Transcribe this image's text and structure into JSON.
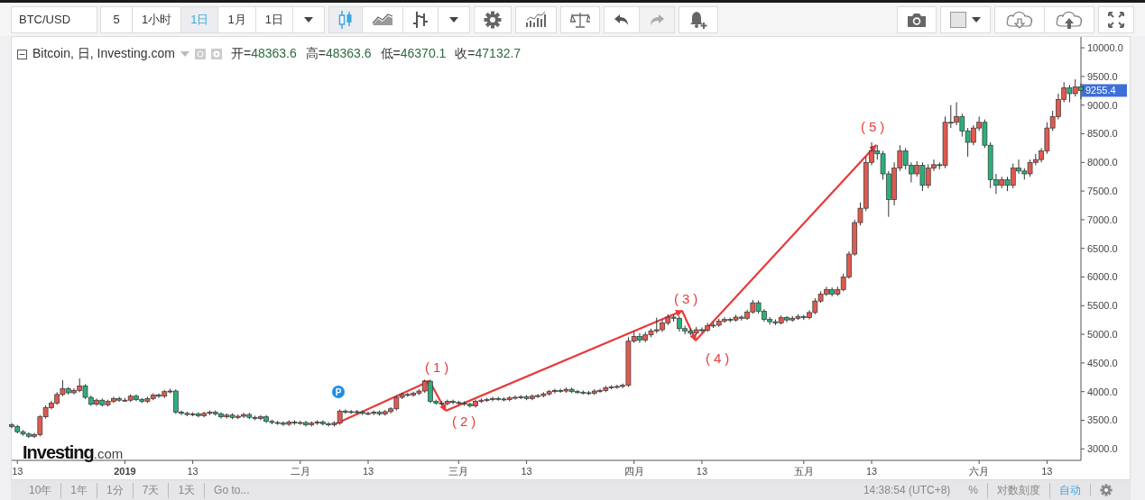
{
  "toolbar": {
    "symbol": "BTC/USD",
    "intervals": [
      {
        "label": "5",
        "selected": false
      },
      {
        "label": "1小时",
        "selected": false
      },
      {
        "label": "1日",
        "selected": true
      },
      {
        "label": "1月",
        "selected": false
      },
      {
        "label": "1日",
        "selected": false
      }
    ],
    "chart_types": [
      {
        "kind": "candles",
        "selected": true
      },
      {
        "kind": "area",
        "selected": false
      },
      {
        "kind": "bars",
        "selected": false
      }
    ],
    "history": [
      {
        "kind": "undo",
        "disabled": false
      },
      {
        "kind": "redo",
        "disabled": true
      }
    ]
  },
  "legend": {
    "title": "Bitcoin, 日, Investing.com",
    "values": [
      {
        "label": "开=",
        "value": "48363.6"
      },
      {
        "label": "高=",
        "value": "48363.6"
      },
      {
        "label": "低=",
        "value": "46370.1"
      },
      {
        "label": "收=",
        "value": "47132.7"
      }
    ]
  },
  "chart": {
    "price_tag": "9255.4",
    "event_marker": "P",
    "annotations": [
      "(1)",
      "(2)",
      "(3)",
      "(4)",
      "(5)"
    ],
    "logo": {
      "name": "Investing",
      "suffix": ".com"
    },
    "chart_data": {
      "type": "candlestick",
      "xlim": [
        "2018-12-12",
        "2019-06-19"
      ],
      "ylim": [
        2800,
        10190
      ],
      "yticks": [
        {
          "value": 10000,
          "label": "10000.0"
        },
        {
          "value": 9500,
          "label": "9500.0"
        },
        {
          "value": 9000,
          "label": "9000.0"
        },
        {
          "value": 8500,
          "label": "8500.0"
        },
        {
          "value": 8000,
          "label": "8000.0"
        },
        {
          "value": 7500,
          "label": "7500.0"
        },
        {
          "value": 7000,
          "label": "7000.0"
        },
        {
          "value": 6500,
          "label": "6500.0"
        },
        {
          "value": 6000,
          "label": "6000.0"
        },
        {
          "value": 5500,
          "label": "5500.0"
        },
        {
          "value": 5000,
          "label": "5000.0"
        },
        {
          "value": 4500,
          "label": "4500.0"
        },
        {
          "value": 4000,
          "label": "4000.0"
        },
        {
          "value": 3500,
          "label": "3500.0"
        },
        {
          "value": 3000,
          "label": "3000.0"
        }
      ],
      "xticks": [
        {
          "value": "2018-12-13",
          "label": "13"
        },
        {
          "value": "2019-01-01",
          "label": "2019"
        },
        {
          "value": "2019-01-13",
          "label": "13"
        },
        {
          "value": "2019-02-01",
          "label": "二月"
        },
        {
          "value": "2019-02-13",
          "label": "13"
        },
        {
          "value": "2019-03-01",
          "label": "三月"
        },
        {
          "value": "2019-03-13",
          "label": "13"
        },
        {
          "value": "2019-04-01",
          "label": "四月"
        },
        {
          "value": "2019-04-13",
          "label": "13"
        },
        {
          "value": "2019-05-01",
          "label": "五月"
        },
        {
          "value": "2019-05-13",
          "label": "13"
        },
        {
          "value": "2019-06-01",
          "label": "六月"
        },
        {
          "value": "2019-06-13",
          "label": "13"
        }
      ],
      "x": [
        "2018-12-12",
        "2018-12-13",
        "2018-12-14",
        "2018-12-15",
        "2018-12-16",
        "2018-12-17",
        "2018-12-18",
        "2018-12-19",
        "2018-12-20",
        "2018-12-21",
        "2018-12-22",
        "2018-12-23",
        "2018-12-24",
        "2018-12-25",
        "2018-12-26",
        "2018-12-27",
        "2018-12-28",
        "2018-12-29",
        "2018-12-30",
        "2018-12-31",
        "2019-01-01",
        "2019-01-02",
        "2019-01-03",
        "2019-01-04",
        "2019-01-05",
        "2019-01-06",
        "2019-01-07",
        "2019-01-08",
        "2019-01-09",
        "2019-01-10",
        "2019-01-11",
        "2019-01-12",
        "2019-01-13",
        "2019-01-14",
        "2019-01-15",
        "2019-01-16",
        "2019-01-17",
        "2019-01-18",
        "2019-01-19",
        "2019-01-20",
        "2019-01-21",
        "2019-01-22",
        "2019-01-23",
        "2019-01-24",
        "2019-01-25",
        "2019-01-26",
        "2019-01-27",
        "2019-01-28",
        "2019-01-29",
        "2019-01-30",
        "2019-01-31",
        "2019-02-01",
        "2019-02-02",
        "2019-02-03",
        "2019-02-04",
        "2019-02-05",
        "2019-02-06",
        "2019-02-07",
        "2019-02-08",
        "2019-02-09",
        "2019-02-10",
        "2019-02-11",
        "2019-02-12",
        "2019-02-13",
        "2019-02-14",
        "2019-02-15",
        "2019-02-16",
        "2019-02-17",
        "2019-02-18",
        "2019-02-19",
        "2019-02-20",
        "2019-02-21",
        "2019-02-22",
        "2019-02-23",
        "2019-02-24",
        "2019-02-25",
        "2019-02-26",
        "2019-02-27",
        "2019-02-28",
        "2019-03-01",
        "2019-03-02",
        "2019-03-03",
        "2019-03-04",
        "2019-03-05",
        "2019-03-06",
        "2019-03-07",
        "2019-03-08",
        "2019-03-09",
        "2019-03-10",
        "2019-03-11",
        "2019-03-12",
        "2019-03-13",
        "2019-03-14",
        "2019-03-15",
        "2019-03-16",
        "2019-03-17",
        "2019-03-18",
        "2019-03-19",
        "2019-03-20",
        "2019-03-21",
        "2019-03-22",
        "2019-03-23",
        "2019-03-24",
        "2019-03-25",
        "2019-03-26",
        "2019-03-27",
        "2019-03-28",
        "2019-03-29",
        "2019-03-30",
        "2019-03-31",
        "2019-04-01",
        "2019-04-02",
        "2019-04-03",
        "2019-04-04",
        "2019-04-05",
        "2019-04-06",
        "2019-04-07",
        "2019-04-08",
        "2019-04-09",
        "2019-04-10",
        "2019-04-11",
        "2019-04-12",
        "2019-04-13",
        "2019-04-14",
        "2019-04-15",
        "2019-04-16",
        "2019-04-17",
        "2019-04-18",
        "2019-04-19",
        "2019-04-20",
        "2019-04-21",
        "2019-04-22",
        "2019-04-23",
        "2019-04-24",
        "2019-04-25",
        "2019-04-26",
        "2019-04-27",
        "2019-04-28",
        "2019-04-29",
        "2019-04-30",
        "2019-05-01",
        "2019-05-02",
        "2019-05-03",
        "2019-05-04",
        "2019-05-05",
        "2019-05-06",
        "2019-05-07",
        "2019-05-08",
        "2019-05-09",
        "2019-05-10",
        "2019-05-11",
        "2019-05-12",
        "2019-05-13",
        "2019-05-14",
        "2019-05-15",
        "2019-05-16",
        "2019-05-17",
        "2019-05-18",
        "2019-05-19",
        "2019-05-20",
        "2019-05-21",
        "2019-05-22",
        "2019-05-23",
        "2019-05-24",
        "2019-05-25",
        "2019-05-26",
        "2019-05-27",
        "2019-05-28",
        "2019-05-29",
        "2019-05-30",
        "2019-05-31",
        "2019-06-01",
        "2019-06-02",
        "2019-06-03",
        "2019-06-04",
        "2019-06-05",
        "2019-06-06",
        "2019-06-07",
        "2019-06-08",
        "2019-06-09",
        "2019-06-10",
        "2019-06-11",
        "2019-06-12",
        "2019-06-13",
        "2019-06-14",
        "2019-06-15",
        "2019-06-16",
        "2019-06-17",
        "2019-06-18",
        "2019-06-19"
      ],
      "ohlc": [
        [
          3420,
          3450,
          3360,
          3390
        ],
        [
          3390,
          3420,
          3270,
          3300
        ],
        [
          3300,
          3330,
          3230,
          3260
        ],
        [
          3260,
          3290,
          3190,
          3220
        ],
        [
          3220,
          3280,
          3190,
          3250
        ],
        [
          3250,
          3590,
          3220,
          3560
        ],
        [
          3560,
          3760,
          3530,
          3720
        ],
        [
          3720,
          3840,
          3690,
          3800
        ],
        [
          3800,
          3990,
          3770,
          3950
        ],
        [
          3950,
          4200,
          3920,
          4050
        ],
        [
          4050,
          4080,
          3950,
          3980
        ],
        [
          3980,
          4060,
          3950,
          4020
        ],
        [
          4020,
          4230,
          3990,
          4100
        ],
        [
          4100,
          4130,
          3870,
          3900
        ],
        [
          3900,
          3930,
          3750,
          3780
        ],
        [
          3780,
          3880,
          3750,
          3850
        ],
        [
          3850,
          3880,
          3740,
          3770
        ],
        [
          3770,
          3860,
          3740,
          3830
        ],
        [
          3830,
          3910,
          3800,
          3880
        ],
        [
          3880,
          3910,
          3820,
          3850
        ],
        [
          3850,
          3890,
          3820,
          3850
        ],
        [
          3850,
          3950,
          3820,
          3920
        ],
        [
          3920,
          3950,
          3830,
          3860
        ],
        [
          3860,
          3890,
          3800,
          3830
        ],
        [
          3830,
          3910,
          3800,
          3880
        ],
        [
          3880,
          3970,
          3850,
          3940
        ],
        [
          3940,
          3970,
          3890,
          3920
        ],
        [
          3920,
          4030,
          3890,
          4000
        ],
        [
          4000,
          4050,
          3970,
          4010
        ],
        [
          4010,
          4040,
          3610,
          3640
        ],
        [
          3640,
          3670,
          3590,
          3620
        ],
        [
          3620,
          3650,
          3570,
          3600
        ],
        [
          3600,
          3640,
          3570,
          3610
        ],
        [
          3610,
          3640,
          3550,
          3580
        ],
        [
          3580,
          3650,
          3550,
          3620
        ],
        [
          3620,
          3670,
          3590,
          3640
        ],
        [
          3640,
          3670,
          3580,
          3610
        ],
        [
          3610,
          3640,
          3530,
          3560
        ],
        [
          3560,
          3620,
          3530,
          3590
        ],
        [
          3590,
          3620,
          3520,
          3550
        ],
        [
          3550,
          3600,
          3520,
          3570
        ],
        [
          3570,
          3630,
          3540,
          3600
        ],
        [
          3600,
          3630,
          3520,
          3550
        ],
        [
          3550,
          3580,
          3500,
          3530
        ],
        [
          3530,
          3590,
          3500,
          3560
        ],
        [
          3560,
          3590,
          3450,
          3480
        ],
        [
          3480,
          3510,
          3430,
          3460
        ],
        [
          3460,
          3490,
          3420,
          3450
        ],
        [
          3450,
          3480,
          3400,
          3430
        ],
        [
          3430,
          3500,
          3400,
          3470
        ],
        [
          3470,
          3500,
          3420,
          3450
        ],
        [
          3450,
          3490,
          3420,
          3460
        ],
        [
          3460,
          3490,
          3390,
          3420
        ],
        [
          3420,
          3480,
          3390,
          3450
        ],
        [
          3450,
          3500,
          3420,
          3470
        ],
        [
          3470,
          3500,
          3410,
          3440
        ],
        [
          3440,
          3470,
          3390,
          3420
        ],
        [
          3420,
          3480,
          3390,
          3450
        ],
        [
          3450,
          3690,
          3420,
          3660
        ],
        [
          3660,
          3690,
          3610,
          3640
        ],
        [
          3640,
          3680,
          3610,
          3650
        ],
        [
          3650,
          3680,
          3610,
          3640
        ],
        [
          3640,
          3670,
          3590,
          3620
        ],
        [
          3620,
          3650,
          3590,
          3620
        ],
        [
          3620,
          3670,
          3590,
          3640
        ],
        [
          3640,
          3670,
          3580,
          3610
        ],
        [
          3610,
          3680,
          3580,
          3650
        ],
        [
          3650,
          3730,
          3620,
          3700
        ],
        [
          3700,
          3930,
          3670,
          3900
        ],
        [
          3900,
          3980,
          3870,
          3950
        ],
        [
          3950,
          3980,
          3910,
          3940
        ],
        [
          3940,
          4000,
          3910,
          3970
        ],
        [
          3970,
          4040,
          3940,
          4010
        ],
        [
          4010,
          4210,
          3980,
          4180
        ],
        [
          4180,
          4210,
          3800,
          3830
        ],
        [
          3830,
          3860,
          3770,
          3800
        ],
        [
          3800,
          3830,
          3760,
          3790
        ],
        [
          3790,
          3860,
          3760,
          3830
        ],
        [
          3830,
          3860,
          3780,
          3810
        ],
        [
          3810,
          3840,
          3770,
          3800
        ],
        [
          3800,
          3830,
          3750,
          3780
        ],
        [
          3780,
          3810,
          3720,
          3750
        ],
        [
          3750,
          3860,
          3720,
          3830
        ],
        [
          3830,
          3880,
          3800,
          3850
        ],
        [
          3850,
          3890,
          3820,
          3860
        ],
        [
          3860,
          3910,
          3830,
          3880
        ],
        [
          3880,
          3910,
          3840,
          3870
        ],
        [
          3870,
          3900,
          3830,
          3860
        ],
        [
          3860,
          3920,
          3830,
          3890
        ],
        [
          3890,
          3930,
          3860,
          3900
        ],
        [
          3900,
          3940,
          3870,
          3910
        ],
        [
          3910,
          3940,
          3850,
          3880
        ],
        [
          3880,
          3950,
          3850,
          3920
        ],
        [
          3920,
          3960,
          3890,
          3930
        ],
        [
          3930,
          3990,
          3900,
          3960
        ],
        [
          3960,
          4030,
          3930,
          4000
        ],
        [
          4000,
          4050,
          3970,
          4020
        ],
        [
          4020,
          4050,
          3980,
          4010
        ],
        [
          4010,
          4070,
          3980,
          4040
        ],
        [
          4040,
          4070,
          3970,
          4000
        ],
        [
          4000,
          4030,
          3960,
          3990
        ],
        [
          3990,
          4020,
          3950,
          3980
        ],
        [
          3980,
          4010,
          3940,
          3970
        ],
        [
          3970,
          4040,
          3940,
          4010
        ],
        [
          4010,
          4050,
          3980,
          4020
        ],
        [
          4020,
          4100,
          3990,
          4070
        ],
        [
          4070,
          4110,
          4040,
          4080
        ],
        [
          4080,
          4120,
          4050,
          4090
        ],
        [
          4090,
          4140,
          4060,
          4110
        ],
        [
          4110,
          4950,
          4080,
          4880
        ],
        [
          4880,
          5050,
          4850,
          4960
        ],
        [
          4960,
          5020,
          4850,
          4900
        ],
        [
          4900,
          5040,
          4860,
          4990
        ],
        [
          4990,
          5100,
          4950,
          5060
        ],
        [
          5060,
          5290,
          5020,
          5080
        ],
        [
          5080,
          5250,
          5040,
          5200
        ],
        [
          5200,
          5350,
          5160,
          5300
        ],
        [
          5300,
          5340,
          5220,
          5280
        ],
        [
          5280,
          5320,
          5050,
          5100
        ],
        [
          5100,
          5150,
          5000,
          5060
        ],
        [
          5060,
          5100,
          4980,
          5020
        ],
        [
          5020,
          5130,
          4990,
          5080
        ],
        [
          5080,
          5120,
          5030,
          5070
        ],
        [
          5070,
          5200,
          5040,
          5150
        ],
        [
          5150,
          5210,
          5110,
          5160
        ],
        [
          5160,
          5270,
          5130,
          5230
        ],
        [
          5230,
          5300,
          5200,
          5260
        ],
        [
          5260,
          5290,
          5210,
          5250
        ],
        [
          5250,
          5340,
          5220,
          5300
        ],
        [
          5300,
          5330,
          5240,
          5280
        ],
        [
          5280,
          5430,
          5250,
          5390
        ],
        [
          5390,
          5600,
          5360,
          5550
        ],
        [
          5550,
          5590,
          5360,
          5400
        ],
        [
          5400,
          5440,
          5220,
          5260
        ],
        [
          5260,
          5300,
          5170,
          5220
        ],
        [
          5220,
          5260,
          5160,
          5200
        ],
        [
          5200,
          5330,
          5170,
          5290
        ],
        [
          5290,
          5320,
          5210,
          5250
        ],
        [
          5250,
          5320,
          5220,
          5280
        ],
        [
          5280,
          5350,
          5250,
          5310
        ],
        [
          5310,
          5340,
          5250,
          5290
        ],
        [
          5290,
          5420,
          5260,
          5380
        ],
        [
          5380,
          5630,
          5350,
          5580
        ],
        [
          5580,
          5750,
          5550,
          5700
        ],
        [
          5700,
          5830,
          5670,
          5780
        ],
        [
          5780,
          5820,
          5660,
          5700
        ],
        [
          5700,
          5830,
          5670,
          5780
        ],
        [
          5780,
          6060,
          5750,
          6000
        ],
        [
          6000,
          6450,
          5970,
          6400
        ],
        [
          6400,
          7000,
          6370,
          6950
        ],
        [
          6950,
          7300,
          6900,
          7200
        ],
        [
          7200,
          8100,
          7150,
          8000
        ],
        [
          8000,
          8350,
          7950,
          8200
        ],
        [
          8200,
          8300,
          8050,
          8150
        ],
        [
          8150,
          8200,
          7700,
          7800
        ],
        [
          7800,
          7850,
          7050,
          7350
        ],
        [
          7350,
          8000,
          7250,
          7900
        ],
        [
          7900,
          8300,
          7850,
          8200
        ],
        [
          8200,
          8250,
          7880,
          7950
        ],
        [
          7950,
          8000,
          7650,
          7800
        ],
        [
          7800,
          8020,
          7750,
          7950
        ],
        [
          7950,
          8000,
          7500,
          7600
        ],
        [
          7600,
          7970,
          7550,
          7900
        ],
        [
          7900,
          8050,
          7850,
          7960
        ],
        [
          7960,
          8000,
          7880,
          7950
        ],
        [
          7950,
          8800,
          7900,
          8700
        ],
        [
          8700,
          9000,
          8600,
          8700
        ],
        [
          8700,
          9050,
          8650,
          8800
        ],
        [
          8800,
          8850,
          8450,
          8550
        ],
        [
          8550,
          8600,
          8100,
          8350
        ],
        [
          8350,
          8650,
          8300,
          8600
        ],
        [
          8600,
          8800,
          8550,
          8700
        ],
        [
          8700,
          8750,
          8250,
          8300
        ],
        [
          8300,
          8350,
          7550,
          7700
        ],
        [
          7700,
          7800,
          7450,
          7600
        ],
        [
          7600,
          7750,
          7550,
          7700
        ],
        [
          7700,
          7750,
          7500,
          7600
        ],
        [
          7600,
          7980,
          7550,
          7900
        ],
        [
          7900,
          8050,
          7800,
          7850
        ],
        [
          7850,
          7900,
          7700,
          7800
        ],
        [
          7800,
          8050,
          7750,
          8000
        ],
        [
          8000,
          8150,
          7950,
          8050
        ],
        [
          8050,
          8250,
          8000,
          8200
        ],
        [
          8200,
          8700,
          8150,
          8600
        ],
        [
          8600,
          8900,
          8550,
          8800
        ],
        [
          8800,
          9200,
          8750,
          9100
        ],
        [
          9100,
          9400,
          9050,
          9300
        ],
        [
          9300,
          9350,
          9050,
          9200
        ],
        [
          9200,
          9450,
          9150,
          9320
        ],
        [
          9320,
          9380,
          9100,
          9255
        ]
      ]
    }
  },
  "bottom_bar": {
    "ranges": [
      "10年",
      "1年",
      "1分",
      "7天",
      "1天",
      "Go to..."
    ],
    "clock": "14:38:54 (UTC+8)",
    "scale_options": [
      {
        "label": "%",
        "selected": false
      },
      {
        "label": "对数刻度",
        "selected": false
      },
      {
        "label": "自动",
        "selected": true
      }
    ]
  }
}
